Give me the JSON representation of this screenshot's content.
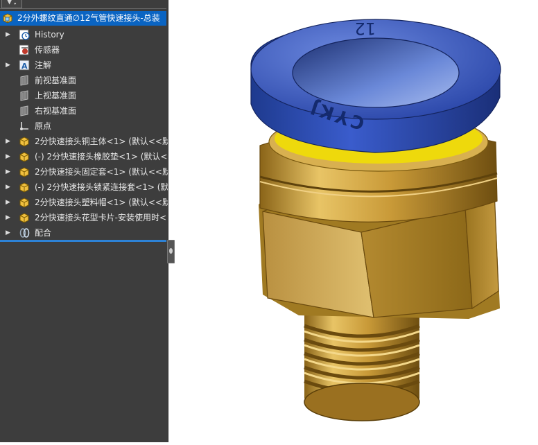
{
  "filter": {
    "icon": "filter-icon"
  },
  "tree": {
    "root": {
      "label": "2分外螺纹直通∅12气管快速接头-总装",
      "icon": "assembly-icon",
      "selected": true
    },
    "items": [
      {
        "label": "History",
        "icon": "history-icon",
        "expandable": true
      },
      {
        "label": "传感器",
        "icon": "sensor-icon",
        "expandable": false
      },
      {
        "label": "注解",
        "icon": "annotation-icon",
        "expandable": true
      },
      {
        "label": "前视基准面",
        "icon": "plane-icon",
        "expandable": false
      },
      {
        "label": "上视基准面",
        "icon": "plane-icon",
        "expandable": false
      },
      {
        "label": "右视基准面",
        "icon": "plane-icon",
        "expandable": false
      },
      {
        "label": "原点",
        "icon": "origin-icon",
        "expandable": false
      },
      {
        "label": "2分快速接头铜主体<1> (默认<<默",
        "icon": "part-icon",
        "expandable": true
      },
      {
        "label": "(-) 2分快速接头橡胶垫<1> (默认<<",
        "icon": "part-icon",
        "expandable": true
      },
      {
        "label": "2分快速接头固定套<1> (默认<<默",
        "icon": "part-icon",
        "expandable": true
      },
      {
        "label": "(-) 2分快速接头锁紧连接套<1> (默",
        "icon": "part-icon",
        "expandable": true
      },
      {
        "label": "2分快速接头塑料帽<1> (默认<<默",
        "icon": "part-icon",
        "expandable": true
      },
      {
        "label": "2分快速接头花型卡片-安装使用时<",
        "icon": "part-icon",
        "expandable": true
      },
      {
        "label": "配合",
        "icon": "mates-icon",
        "expandable": true
      }
    ]
  },
  "model": {
    "cap_text": "CYKJ",
    "size_text": "12",
    "colors": {
      "cap": "#2e4fb0",
      "brass": "#c8a040",
      "selection": "#0a64c2",
      "panel": "#3d3d3d"
    }
  }
}
